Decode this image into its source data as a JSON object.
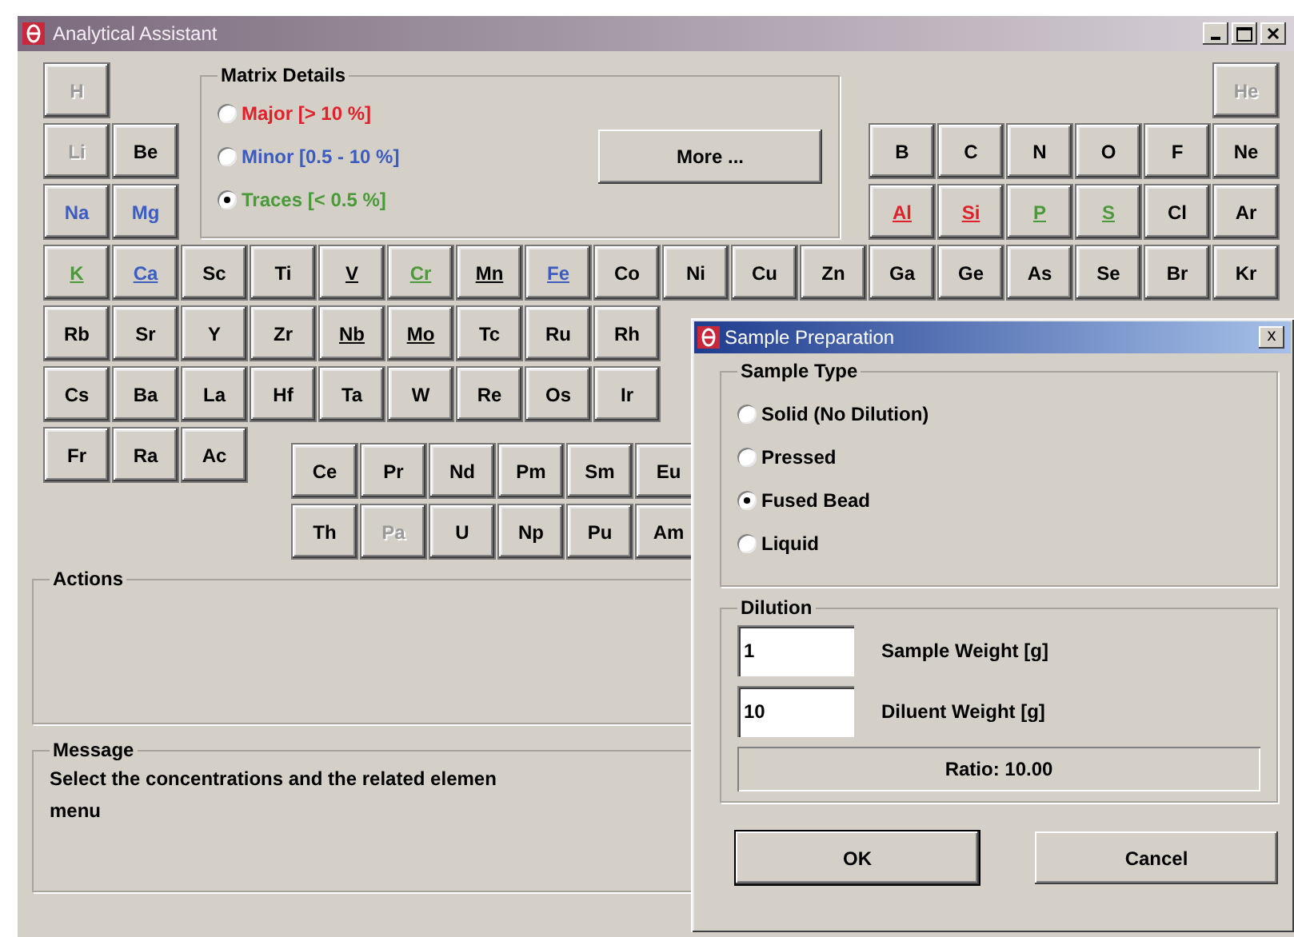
{
  "window": {
    "title": "Analytical Assistant"
  },
  "periodic_table": {
    "rows": [
      [
        {
          "symbol": "H",
          "disabled": true,
          "underlined": false
        },
        null,
        null,
        null,
        null,
        null,
        null,
        null,
        null,
        null,
        null,
        null,
        null,
        null,
        null,
        null,
        null,
        {
          "symbol": "He",
          "disabled": true,
          "underlined": false
        }
      ],
      [
        {
          "symbol": "Li",
          "disabled": true,
          "underlined": false
        },
        {
          "symbol": "Be",
          "disabled": false,
          "underlined": false
        },
        null,
        null,
        null,
        null,
        null,
        null,
        null,
        null,
        null,
        null,
        {
          "symbol": "B",
          "disabled": false,
          "underlined": false
        },
        {
          "symbol": "C",
          "disabled": false,
          "underlined": false
        },
        {
          "symbol": "N",
          "disabled": false,
          "underlined": false
        },
        {
          "symbol": "O",
          "disabled": false,
          "underlined": false
        },
        {
          "symbol": "F",
          "disabled": false,
          "underlined": false
        },
        {
          "symbol": "Ne",
          "disabled": false,
          "underlined": false
        }
      ],
      [
        {
          "symbol": "Na",
          "disabled": false,
          "underlined": false,
          "color": "#3c5cc0"
        },
        {
          "symbol": "Mg",
          "disabled": false,
          "underlined": false,
          "color": "#3c5cc0"
        },
        null,
        null,
        null,
        null,
        null,
        null,
        null,
        null,
        null,
        null,
        {
          "symbol": "Al",
          "disabled": false,
          "underlined": true,
          "color": "#e0202a"
        },
        {
          "symbol": "Si",
          "disabled": false,
          "underlined": true,
          "color": "#e0202a"
        },
        {
          "symbol": "P",
          "disabled": false,
          "underlined": true,
          "color": "#4a9a3a"
        },
        {
          "symbol": "S",
          "disabled": false,
          "underlined": true,
          "color": "#4a9a3a"
        },
        {
          "symbol": "Cl",
          "disabled": false,
          "underlined": false
        },
        {
          "symbol": "Ar",
          "disabled": false,
          "underlined": false
        }
      ],
      [
        {
          "symbol": "K",
          "disabled": false,
          "underlined": true,
          "color": "#4a9a3a"
        },
        {
          "symbol": "Ca",
          "disabled": false,
          "underlined": true,
          "color": "#3c5cc0"
        },
        {
          "symbol": "Sc",
          "disabled": false,
          "underlined": false
        },
        {
          "symbol": "Ti",
          "disabled": false,
          "underlined": false
        },
        {
          "symbol": "V",
          "disabled": false,
          "underlined": true
        },
        {
          "symbol": "Cr",
          "disabled": false,
          "underlined": true,
          "color": "#4a9a3a"
        },
        {
          "symbol": "Mn",
          "disabled": false,
          "underlined": true
        },
        {
          "symbol": "Fe",
          "disabled": false,
          "underlined": true,
          "color": "#3c5cc0"
        },
        {
          "symbol": "Co",
          "disabled": false,
          "underlined": false
        },
        {
          "symbol": "Ni",
          "disabled": false,
          "underlined": false
        },
        {
          "symbol": "Cu",
          "disabled": false,
          "underlined": false
        },
        {
          "symbol": "Zn",
          "disabled": false,
          "underlined": false
        },
        {
          "symbol": "Ga",
          "disabled": false,
          "underlined": false
        },
        {
          "symbol": "Ge",
          "disabled": false,
          "underlined": false
        },
        {
          "symbol": "As",
          "disabled": false,
          "underlined": false
        },
        {
          "symbol": "Se",
          "disabled": false,
          "underlined": false
        },
        {
          "symbol": "Br",
          "disabled": false,
          "underlined": false
        },
        {
          "symbol": "Kr",
          "disabled": false,
          "underlined": false
        }
      ],
      [
        {
          "symbol": "Rb",
          "disabled": false,
          "underlined": false
        },
        {
          "symbol": "Sr",
          "disabled": false,
          "underlined": false
        },
        {
          "symbol": "Y",
          "disabled": false,
          "underlined": false
        },
        {
          "symbol": "Zr",
          "disabled": false,
          "underlined": false
        },
        {
          "symbol": "Nb",
          "disabled": false,
          "underlined": true
        },
        {
          "symbol": "Mo",
          "disabled": false,
          "underlined": true
        },
        {
          "symbol": "Tc",
          "disabled": false,
          "underlined": false
        },
        {
          "symbol": "Ru",
          "disabled": false,
          "underlined": false
        },
        {
          "symbol": "Rh",
          "disabled": false,
          "underlined": false
        }
      ],
      [
        {
          "symbol": "Cs",
          "disabled": false,
          "underlined": false
        },
        {
          "symbol": "Ba",
          "disabled": false,
          "underlined": false
        },
        {
          "symbol": "La",
          "disabled": false,
          "underlined": false
        },
        {
          "symbol": "Hf",
          "disabled": false,
          "underlined": false
        },
        {
          "symbol": "Ta",
          "disabled": false,
          "underlined": false
        },
        {
          "symbol": "W",
          "disabled": false,
          "underlined": false
        },
        {
          "symbol": "Re",
          "disabled": false,
          "underlined": false
        },
        {
          "symbol": "Os",
          "disabled": false,
          "underlined": false
        },
        {
          "symbol": "Ir",
          "disabled": false,
          "underlined": false
        }
      ],
      [
        {
          "symbol": "Fr",
          "disabled": false,
          "underlined": false
        },
        {
          "symbol": "Ra",
          "disabled": false,
          "underlined": false
        },
        {
          "symbol": "Ac",
          "disabled": false,
          "underlined": false
        }
      ]
    ],
    "lanthanide_rows": [
      [
        {
          "symbol": "Ce",
          "disabled": false,
          "underlined": false
        },
        {
          "symbol": "Pr",
          "disabled": false,
          "underlined": false
        },
        {
          "symbol": "Nd",
          "disabled": false,
          "underlined": false
        },
        {
          "symbol": "Pm",
          "disabled": false,
          "underlined": false
        },
        {
          "symbol": "Sm",
          "disabled": false,
          "underlined": false
        },
        {
          "symbol": "Eu",
          "disabled": false,
          "underlined": false
        }
      ],
      [
        {
          "symbol": "Th",
          "disabled": false,
          "underlined": false
        },
        {
          "symbol": "Pa",
          "disabled": true,
          "underlined": false
        },
        {
          "symbol": "U",
          "disabled": false,
          "underlined": false
        },
        {
          "symbol": "Np",
          "disabled": false,
          "underlined": false
        },
        {
          "symbol": "Pu",
          "disabled": false,
          "underlined": false
        },
        {
          "symbol": "Am",
          "disabled": false,
          "underlined": false
        }
      ]
    ]
  },
  "matrix_details": {
    "title": "Matrix Details",
    "options": [
      {
        "label": "Major [> 10 %]",
        "color": "#e0202a",
        "selected": false
      },
      {
        "label": "Minor [0.5 - 10 %]",
        "color": "#3c5cc0",
        "selected": false
      },
      {
        "label": "Traces [< 0.5 %]",
        "color": "#4a9a3a",
        "selected": true
      }
    ],
    "more_button": "More ..."
  },
  "actions": {
    "title": "Actions"
  },
  "message": {
    "title": "Message",
    "lines": [
      "Select the concentrations and the related elemen",
      "menu"
    ]
  },
  "dialog": {
    "title": "Sample Preparation",
    "close": "x",
    "sample_type": {
      "title": "Sample Type",
      "options": [
        {
          "label": "Solid (No Dilution)",
          "selected": false
        },
        {
          "label": "Pressed",
          "selected": false
        },
        {
          "label": "Fused Bead",
          "selected": true
        },
        {
          "label": "Liquid",
          "selected": false
        }
      ]
    },
    "dilution": {
      "title": "Dilution",
      "fields": [
        {
          "value": "1",
          "label": "Sample Weight [g]"
        },
        {
          "value": "10",
          "label": "Diluent Weight [g]"
        }
      ],
      "ratio": "Ratio: 10.00"
    },
    "buttons": [
      "OK",
      "Cancel"
    ]
  }
}
